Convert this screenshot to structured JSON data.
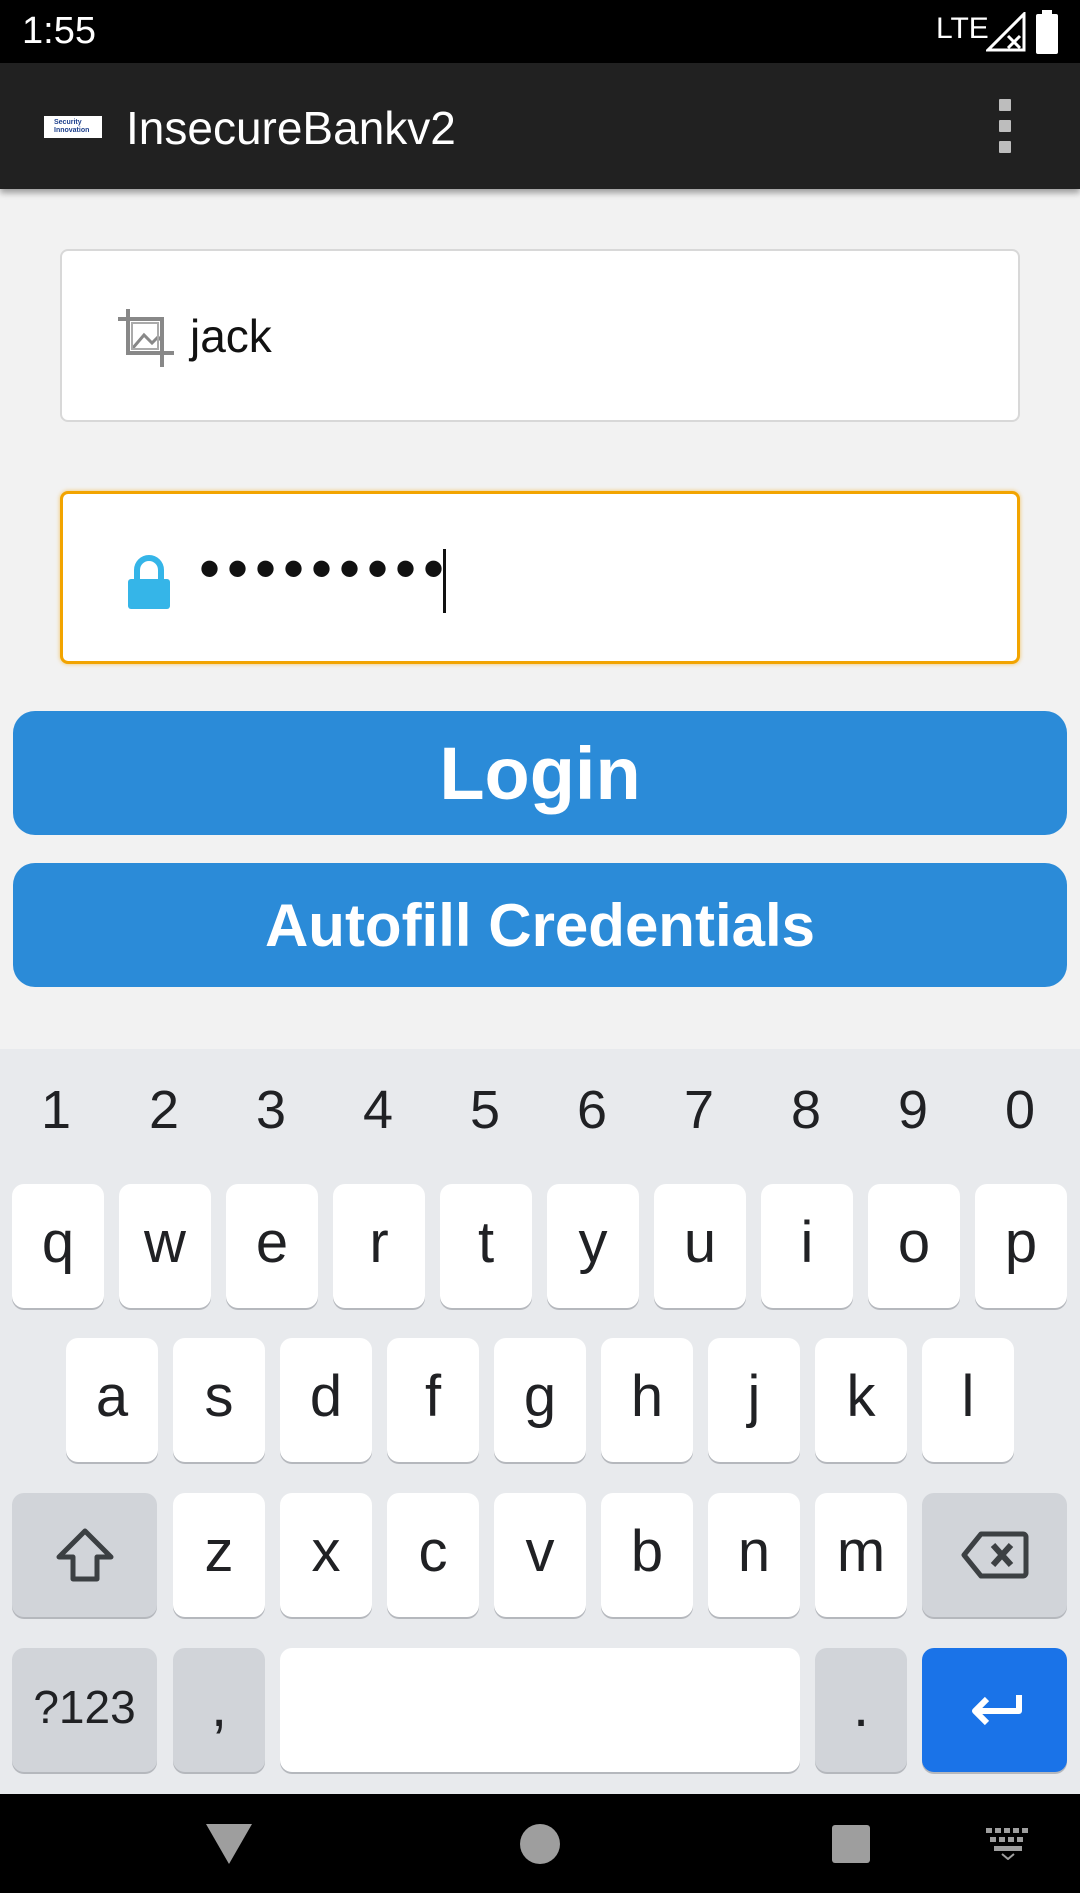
{
  "status_bar": {
    "time": "1:55",
    "network": "LTE"
  },
  "app_bar": {
    "title": "InsecureBankv2",
    "logo_text": "Security Innovation",
    "menu_icon": "more-vert-icon"
  },
  "login_form": {
    "username": {
      "value": "jack",
      "icon": "crop-image-icon"
    },
    "password": {
      "masked_value": "•••••••••",
      "icon": "lock-icon"
    },
    "login_button": "Login",
    "autofill_button": "Autofill Credentials"
  },
  "keyboard": {
    "numbers": [
      "1",
      "2",
      "3",
      "4",
      "5",
      "6",
      "7",
      "8",
      "9",
      "0"
    ],
    "row1": [
      "q",
      "w",
      "e",
      "r",
      "t",
      "y",
      "u",
      "i",
      "o",
      "p"
    ],
    "row2": [
      "a",
      "s",
      "d",
      "f",
      "g",
      "h",
      "j",
      "k",
      "l"
    ],
    "row3": [
      "z",
      "x",
      "c",
      "v",
      "b",
      "n",
      "m"
    ],
    "symbols_key": "?123",
    "comma_key": ",",
    "period_key": "."
  },
  "colors": {
    "accent": "#2b8bd8",
    "focus": "#f2a400",
    "enter": "#1a73e8",
    "lock": "#35b5e8"
  }
}
